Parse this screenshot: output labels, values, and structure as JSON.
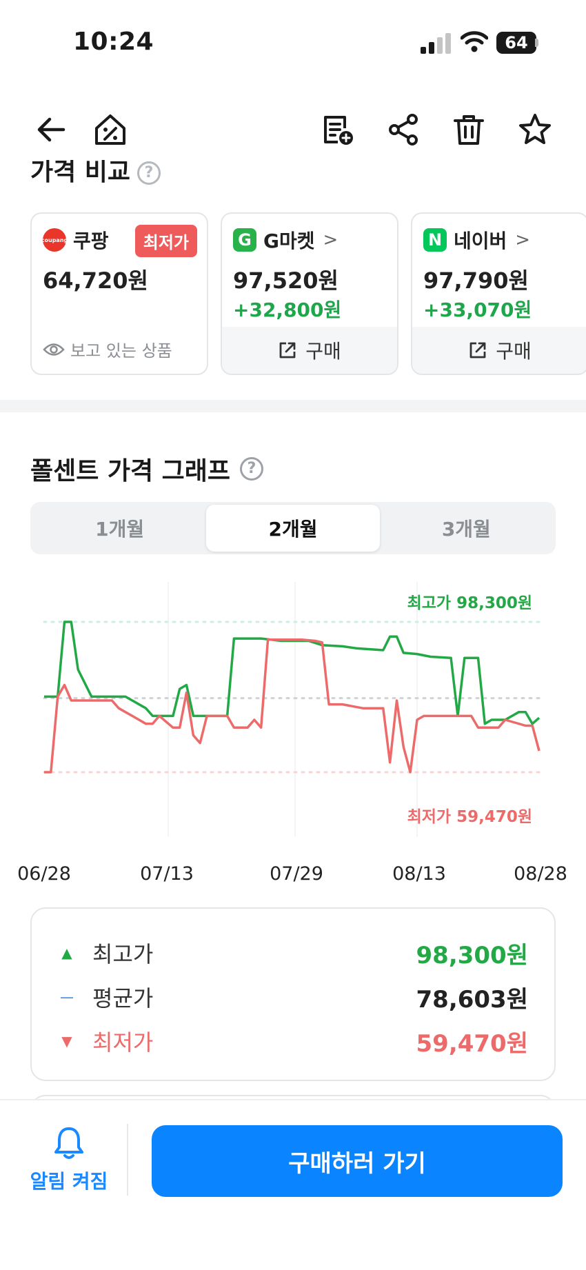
{
  "status": {
    "time": "10:24",
    "battery": "64"
  },
  "nav": {
    "icons": [
      "back-arrow-icon",
      "price-tag-home-icon",
      "add-to-list-icon",
      "share-icon",
      "trash-icon",
      "star-icon"
    ]
  },
  "compare": {
    "title": "가격 비교",
    "help": "?",
    "cards": [
      {
        "store": "쿠팡",
        "logo_text": "coupang",
        "logo_color": "#e9352a",
        "badge": "최저가",
        "price": "64,720원",
        "note": "보고 있는 상품"
      },
      {
        "store": "G마켓",
        "logo_text": "G",
        "logo_color": "#27b24a",
        "price": "97,520원",
        "diff": "+32,800원",
        "action": "구매"
      },
      {
        "store": "네이버",
        "logo_text": "N",
        "logo_color": "#03c75a",
        "price": "97,790원",
        "diff": "+33,070원",
        "action": "구매"
      }
    ]
  },
  "graph": {
    "title": "폴센트 가격 그래프",
    "help": "?",
    "tabs": [
      {
        "label": "1개월",
        "active": false
      },
      {
        "label": "2개월",
        "active": true
      },
      {
        "label": "3개월",
        "active": false
      }
    ],
    "max_label": "최고가 98,300원",
    "min_label": "최저가 59,470원"
  },
  "chart_data": {
    "type": "line",
    "x_ticks": [
      "06/28",
      "07/13",
      "07/29",
      "08/13",
      "08/28"
    ],
    "ylim": [
      59470,
      98300
    ],
    "reference_lines": {
      "max": 98300,
      "avg": 78603,
      "min": 59470
    },
    "series": [
      {
        "color": "#22a845",
        "points": [
          [
            0,
            79000
          ],
          [
            2,
            79000
          ],
          [
            3,
            98300
          ],
          [
            4,
            98300
          ],
          [
            5,
            86000
          ],
          [
            7,
            79000
          ],
          [
            12,
            79000
          ],
          [
            13,
            78000
          ],
          [
            15,
            76000
          ],
          [
            16,
            74000
          ],
          [
            19,
            74000
          ],
          [
            20,
            81000
          ],
          [
            21,
            82000
          ],
          [
            22,
            74000
          ],
          [
            25,
            74000
          ],
          [
            27,
            74000
          ],
          [
            28,
            94000
          ],
          [
            32,
            94000
          ],
          [
            35,
            93400
          ],
          [
            39,
            93400
          ],
          [
            41,
            92300
          ],
          [
            44,
            92000
          ],
          [
            46,
            91500
          ],
          [
            50,
            91000
          ],
          [
            51,
            94500
          ],
          [
            52,
            94500
          ],
          [
            53,
            90300
          ],
          [
            55,
            90000
          ],
          [
            57,
            89300
          ],
          [
            60,
            89000
          ],
          [
            61,
            74000
          ],
          [
            62,
            89000
          ],
          [
            64,
            89000
          ],
          [
            65,
            72000
          ],
          [
            66,
            73000
          ],
          [
            68,
            73000
          ],
          [
            70,
            75000
          ],
          [
            71,
            75000
          ],
          [
            72,
            72000
          ],
          [
            73,
            73500
          ]
        ]
      },
      {
        "color": "#ed6a6a",
        "points": [
          [
            0,
            59470
          ],
          [
            1,
            59470
          ],
          [
            2,
            79000
          ],
          [
            3,
            82000
          ],
          [
            4,
            78000
          ],
          [
            5,
            78000
          ],
          [
            8,
            78000
          ],
          [
            10,
            78000
          ],
          [
            11,
            76000
          ],
          [
            12,
            75000
          ],
          [
            13,
            74000
          ],
          [
            15,
            72000
          ],
          [
            16,
            72000
          ],
          [
            17,
            74000
          ],
          [
            19,
            71000
          ],
          [
            20,
            71000
          ],
          [
            21,
            80000
          ],
          [
            22,
            69000
          ],
          [
            23,
            67000
          ],
          [
            24,
            74000
          ],
          [
            27,
            74000
          ],
          [
            28,
            71000
          ],
          [
            30,
            71000
          ],
          [
            31,
            73000
          ],
          [
            32,
            71000
          ],
          [
            33,
            93700
          ],
          [
            35,
            93700
          ],
          [
            38,
            93700
          ],
          [
            40,
            93400
          ],
          [
            41,
            93000
          ],
          [
            42,
            77000
          ],
          [
            44,
            77000
          ],
          [
            47,
            76000
          ],
          [
            50,
            76000
          ],
          [
            51,
            62000
          ],
          [
            52,
            78000
          ],
          [
            53,
            66000
          ],
          [
            54,
            59470
          ],
          [
            55,
            73000
          ],
          [
            56,
            74000
          ],
          [
            59,
            74000
          ],
          [
            63,
            74000
          ],
          [
            64,
            71000
          ],
          [
            67,
            71000
          ],
          [
            68,
            73000
          ],
          [
            71,
            71500
          ],
          [
            72,
            71500
          ],
          [
            73,
            65000
          ]
        ]
      }
    ]
  },
  "stats": {
    "max": {
      "mark": "▲",
      "label": "최고가",
      "value": "98,300원"
    },
    "avg": {
      "mark": "—",
      "label": "평균가",
      "value": "78,603원"
    },
    "min": {
      "mark": "▼",
      "label": "최저가",
      "value": "59,470원"
    }
  },
  "bottom": {
    "alarm_label": "알림 켜짐",
    "buy_label": "구매하러 가기"
  }
}
